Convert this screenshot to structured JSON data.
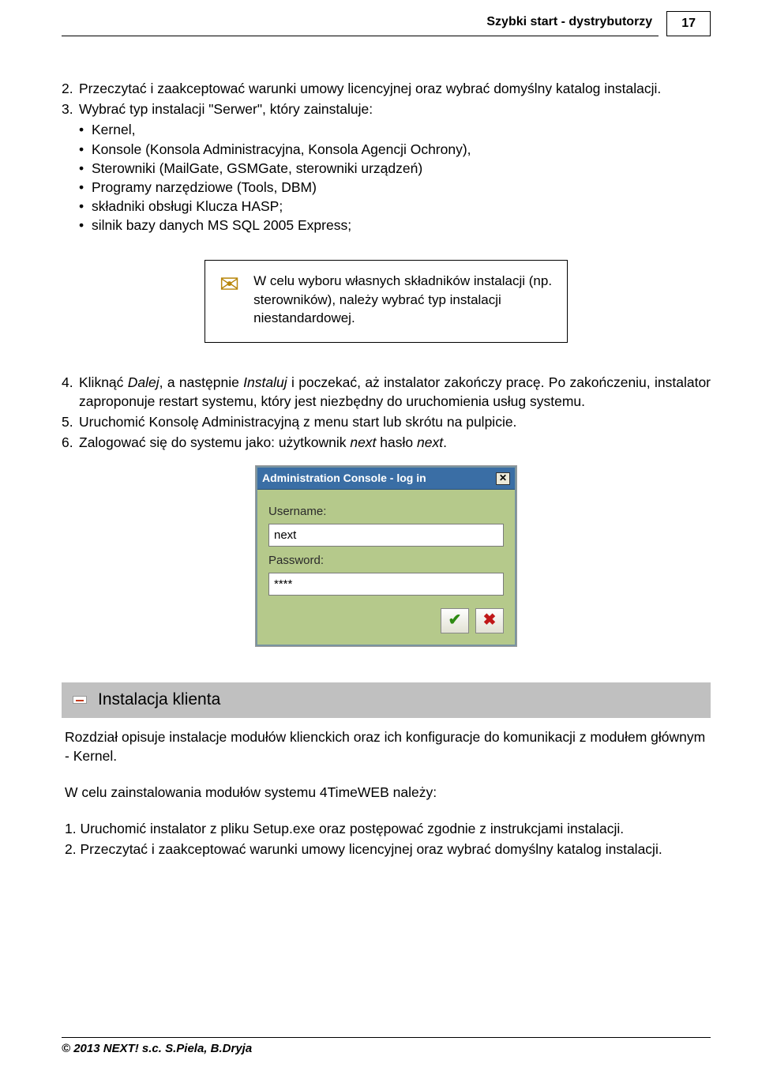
{
  "header": {
    "title": "Szybki start - dystrybutorzy",
    "page_number": "17"
  },
  "list1": {
    "item2": {
      "num": "2.",
      "text": "Przeczytać i zaakceptować warunki umowy licencyjnej oraz wybrać domyślny katalog instalacji."
    },
    "item3": {
      "num": "3.",
      "text": "Wybrać typ  instalacji \"Serwer\", który zainstaluje:"
    },
    "sub": [
      "Kernel,",
      "Konsole (Konsola Administracyjna, Konsola Agencji Ochrony),",
      "Sterowniki (MailGate, GSMGate, sterowniki urządzeń)",
      "Programy narzędziowe (Tools, DBM)",
      "składniki obsługi Klucza HASP;",
      "silnik bazy danych MS SQL 2005 Express;"
    ]
  },
  "notebox": "W celu wyboru własnych składników instalacji (np. sterowników), należy wybrać typ instalacji niestandardowej.",
  "list2": {
    "item4": {
      "num": "4.",
      "pre": "Kliknąć ",
      "i1": "Dalej",
      "mid1": ", a następnie ",
      "i2": "Instaluj",
      "mid2": " i poczekać, aż instalator zakończy pracę. Po zakończeniu, instalator zaproponuje restart systemu, który jest niezbędny do uruchomienia usług systemu."
    },
    "item5": {
      "num": "5.",
      "text": "Uruchomić Konsolę Administracyjną z menu start lub skrótu na pulpicie."
    },
    "item6": {
      "num": "6.",
      "pre": "Zalogować się do systemu jako: użytkownik ",
      "i1": "next",
      "mid1": "  hasło ",
      "i2": "next",
      "post": "."
    }
  },
  "login": {
    "title": "Administration Console - log in",
    "username_label": "Username:",
    "username_value": "next",
    "password_label": "Password:",
    "password_value": "****"
  },
  "section": {
    "title": "Instalacja klienta",
    "p1": "Rozdział  opisuje instalacje modułów klienckich oraz ich konfiguracje do komunikacji z modułem głównym - Kernel.",
    "p2": "W celu zainstalowania modułów systemu 4TimeWEB należy:",
    "l1": "1. Uruchomić instalator z pliku Setup.exe oraz postępować zgodnie z instrukcjami instalacji.",
    "l2": "2. Przeczytać i zaakceptować warunki umowy licencyjnej oraz wybrać domyślny katalog instalacji."
  },
  "footer": "© 2013 NEXT! s.c. S.Piela, B.Dryja"
}
